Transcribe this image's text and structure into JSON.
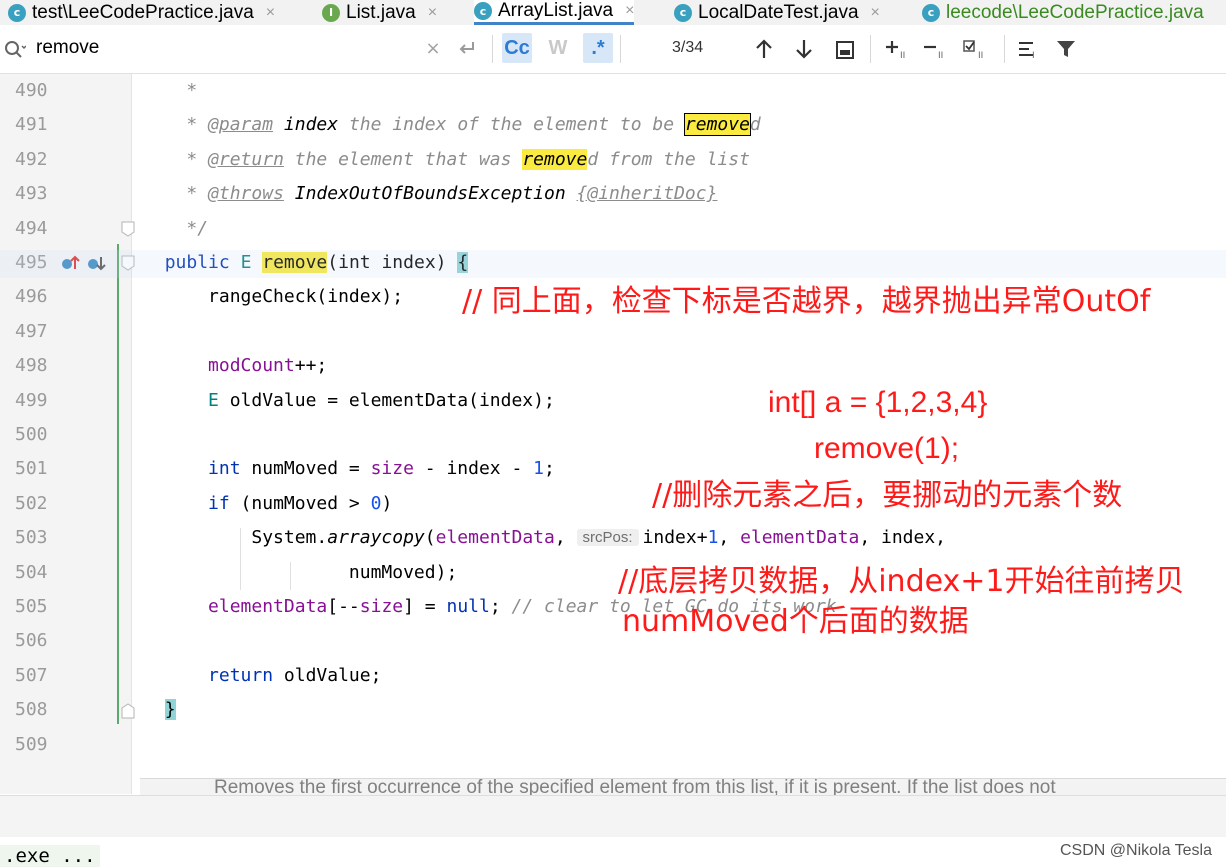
{
  "tabs": [
    {
      "label": "test\\LeeCodePractice.java",
      "icon": "class-icon",
      "active": false
    },
    {
      "label": "List.java",
      "icon": "interface-icon",
      "active": false
    },
    {
      "label": "ArrayList.java",
      "icon": "class-icon",
      "active": true
    },
    {
      "label": "LocalDateTest.java",
      "icon": "class-icon",
      "active": false
    },
    {
      "label": "leecode\\LeeCodePractice.java",
      "icon": "class-icon",
      "active": false
    }
  ],
  "find": {
    "query": "remove",
    "match_case": "Cc",
    "words": "W",
    "regex": ".*",
    "match_count": "3/34"
  },
  "gutter": {
    "line_numbers": [
      "490",
      "491",
      "492",
      "493",
      "494",
      "495",
      "496",
      "497",
      "498",
      "499",
      "500",
      "501",
      "502",
      "503",
      "504",
      "505",
      "506",
      "507",
      "508",
      "509"
    ]
  },
  "code": {
    "l490": "*",
    "l491": {
      "star": "* ",
      "tag": "@param",
      "name": "index",
      "text1": " the index of the element to be ",
      "match": "remove",
      "text2": "d"
    },
    "l492": {
      "star": "* ",
      "tag": "@return",
      "text1": " the element that was ",
      "match": "remove",
      "text2": "d from the list"
    },
    "l493": {
      "star": "* ",
      "tag": "@throws",
      "type": "IndexOutOfBoundsException",
      "inherit": "{@inheritDoc}"
    },
    "l494": "*/",
    "l495": {
      "kw": "public",
      "type": "E",
      "match": "remove",
      "sig": "(int index)",
      "brace": "{"
    },
    "l496": {
      "text": "rangeCheck(index);"
    },
    "l498": {
      "fld": "modCount",
      "text": "++;"
    },
    "l499": {
      "type": "E",
      "text": " oldValue = elementData(index);"
    },
    "l501": {
      "kw": "int",
      "t1": " numMoved = ",
      "fld": "size",
      "t2": " - index - ",
      "num": "1",
      "t3": ";"
    },
    "l502": {
      "kw": "if",
      "t1": " (numMoved > ",
      "num": "0",
      "t2": ")"
    },
    "l503": {
      "t1": "System.",
      "call": "arraycopy",
      "t2": "(",
      "fld1": "elementData",
      "t3": ", ",
      "hint": "srcPos:",
      "t4": "index+",
      "num": "1",
      "t5": ", ",
      "fld2": "elementData",
      "t6": ", index,"
    },
    "l504": {
      "text": "numMoved);"
    },
    "l505": {
      "fld": "elementData",
      "t1": "[--",
      "fld2": "size",
      "t2": "] = ",
      "kw": "null",
      "t3": "; ",
      "cmt": "// clear to let GC do its work"
    },
    "l507": {
      "kw": "return",
      "text": " oldValue;"
    },
    "l508": {
      "brace": "}"
    }
  },
  "annotations": {
    "a1": "// 同上面，检查下标是否越界，越界抛出异常OutOf",
    "a2": "int[] a = {1,2,3,4}",
    "a3": "remove(1);",
    "a4": "//删除元素之后，要挪动的元素个数",
    "a5": "//底层拷贝数据，从index+1开始往前拷贝",
    "a6": "numMoved个后面的数据"
  },
  "doc_popup": "Removes the first occurrence of the specified element from this list, if it is present. If the list does not",
  "run_item": ".exe ...",
  "watermark": "CSDN @Nikola Tesla",
  "colors": {
    "keyword": "#0033b3",
    "field": "#871094",
    "number": "#1750eb",
    "match": "#fbeb40",
    "annotation": "#ff1a1a"
  }
}
